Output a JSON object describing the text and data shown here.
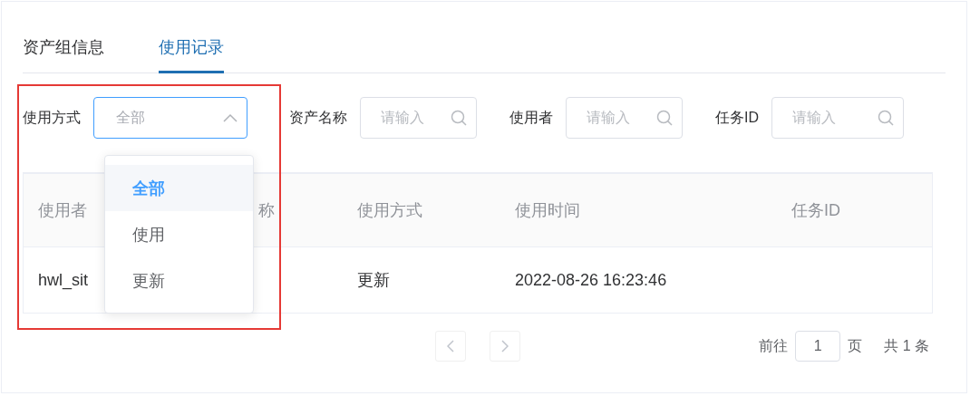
{
  "tabs": [
    {
      "label": "资产组信息",
      "selected": false
    },
    {
      "label": "使用记录",
      "selected": true
    }
  ],
  "filters": [
    {
      "label": "使用方式",
      "kind": "select",
      "value": "全部",
      "expanded": true
    },
    {
      "label": "资产名称",
      "kind": "search",
      "placeholder": "请输入"
    },
    {
      "label": "使用者",
      "kind": "search",
      "placeholder": "请输入"
    },
    {
      "label": "任务ID",
      "kind": "search",
      "placeholder": "请输入"
    }
  ],
  "dropdown": {
    "options": [
      {
        "label": "全部",
        "selected": true
      },
      {
        "label": "使用",
        "selected": false
      },
      {
        "label": "更新",
        "selected": false
      }
    ]
  },
  "table": {
    "columns": [
      "使用者",
      "称",
      "使用方式",
      "使用时间",
      "任务ID"
    ],
    "rows": [
      [
        "hwl_sit",
        "",
        "更新",
        "2022-08-26 16:23:46",
        ""
      ]
    ]
  },
  "pagination": {
    "prev_disabled": true,
    "next_disabled": true,
    "goto_label": "前往",
    "page": "1",
    "page_unit": "页",
    "total": "共 1 条"
  }
}
